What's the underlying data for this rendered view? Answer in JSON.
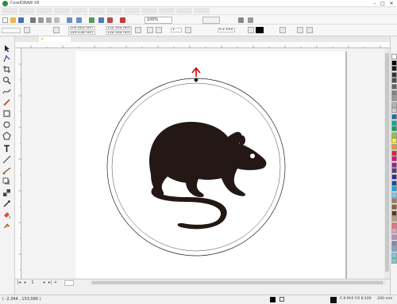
{
  "window": {
    "app_title": "CorelDRAW X8",
    "controls": {
      "minimize": "–",
      "maximize": "□",
      "close": "✕"
    }
  },
  "menubar": {
    "items": [
      "",
      "",
      "",
      "",
      "",
      "",
      "",
      "",
      "",
      "",
      "",
      ""
    ]
  },
  "toolbar": {
    "zoom_value": "100%"
  },
  "propbar": {
    "x_value": "104.465 mm",
    "y_value": "149.058 mm",
    "w_value": "152.334 mm",
    "h_value": "152.334 mm",
    "outline_width": "4.2 mm",
    "node_count": "1"
  },
  "tabs": [
    {
      "label": "",
      "active": false
    },
    {
      "label": "",
      "active": true
    }
  ],
  "page_nav": {
    "first": "|◂",
    "prev": "◂",
    "current": "1",
    "next": "▸",
    "last": "▸|",
    "add": "+"
  },
  "status": {
    "cursor_position": "( -2,344 , 153,080 )",
    "fill_info": "C:0 M:0 Y:0 K:100",
    "outline_info": ".200 mm"
  },
  "colors": {
    "accent": "#2e8b3a",
    "selection_arrow": "#d60000",
    "drawing": "#231815"
  },
  "palette": [
    "#ffffff",
    "#000000",
    "#1a1a1a",
    "#333333",
    "#4d4d4d",
    "#666666",
    "#808080",
    "#999999",
    "#b3b3b3",
    "#cccccc",
    "#0072bc",
    "#00a99d",
    "#00a651",
    "#8dc63f",
    "#fff200",
    "#f7941d",
    "#ed1c24",
    "#ec008c",
    "#92278f",
    "#662d91",
    "#2e3192",
    "#0054a6",
    "#00aeef",
    "#6dcff6",
    "#a67c52",
    "#8c6239",
    "#603913",
    "#c69c6d",
    "#f26d7d",
    "#f49ac1",
    "#bd8cbf",
    "#8781bd",
    "#7da7d9",
    "#6ecff6",
    "#7accc8"
  ]
}
